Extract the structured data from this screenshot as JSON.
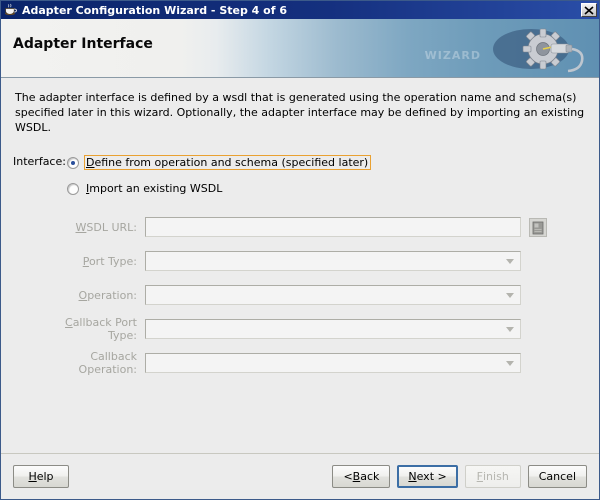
{
  "window": {
    "title": "Adapter Configuration Wizard - Step 4 of 6",
    "app_icon": "java-coffee-cup-icon",
    "close_label": "✕",
    "close_icon": "close-icon"
  },
  "header": {
    "title": "Adapter Interface",
    "watermark": "WIZARD",
    "art_icon": "gear-wrench-icon",
    "accent_color": "#5f90b2"
  },
  "main": {
    "description": "The adapter interface is defined by a wsdl that is generated using the operation name and schema(s) specified later in this wizard.  Optionally, the adapter interface may be defined by importing an existing WSDL.",
    "interface": {
      "label": "Interface:",
      "options": [
        {
          "label_prefix": "",
          "mnemonic": "D",
          "label_rest": "efine from operation and schema (specified later)",
          "selected": true,
          "focused": true
        },
        {
          "label_prefix": "",
          "mnemonic": "I",
          "label_rest": "mport an existing WSDL",
          "selected": false,
          "focused": false
        }
      ]
    },
    "fields": [
      {
        "label_mnemonic": "W",
        "label_rest": "SDL URL:",
        "type": "text",
        "value": "",
        "placeholder": "",
        "disabled": true,
        "browse_icon": "browse-folder-icon"
      },
      {
        "label_mnemonic": "P",
        "label_rest": "ort Type:",
        "type": "combo",
        "value": "",
        "disabled": true
      },
      {
        "label_mnemonic": "O",
        "label_rest": "peration:",
        "type": "combo",
        "value": "",
        "disabled": true
      },
      {
        "label_mnemonic": "C",
        "label_rest": "allback Port Type:",
        "type": "combo",
        "value": "",
        "disabled": true
      },
      {
        "label_mnemonic": "",
        "label_rest": "Callback Operation:",
        "type": "combo",
        "value": "",
        "disabled": true
      }
    ]
  },
  "footer": {
    "help": {
      "mnemonic": "H",
      "rest": "elp"
    },
    "back": {
      "prefix": "< ",
      "mnemonic": "B",
      "rest": "ack"
    },
    "next": {
      "mnemonic": "N",
      "rest": "ext >"
    },
    "finish": {
      "mnemonic": "F",
      "rest": "inish",
      "disabled": true
    },
    "cancel": {
      "mnemonic": "",
      "rest": "Cancel"
    }
  }
}
